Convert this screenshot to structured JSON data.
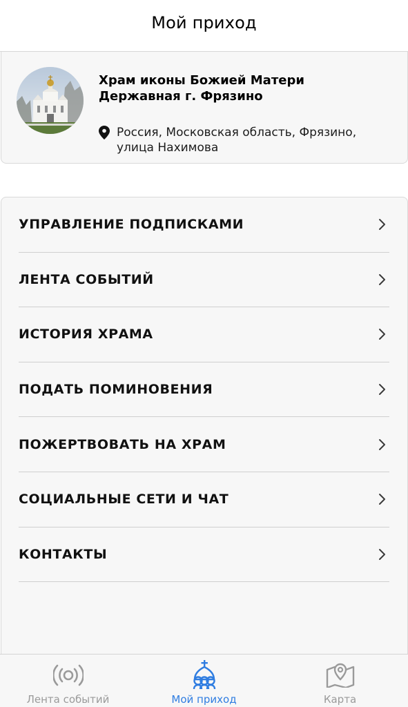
{
  "header": {
    "title": "Мой приход"
  },
  "church": {
    "name_line1": "Храм иконы Божией Матери",
    "name_line2": "Державная г. Фрязино",
    "address": "Россия, Московская область, Фрязино, улица Нахимова",
    "photo_icon": "church-photo",
    "location_icon": "map-pin-icon"
  },
  "menu": {
    "items": [
      {
        "label": "УПРАВЛЕНИЕ ПОДПИСКАМИ"
      },
      {
        "label": "ЛЕНТА СОБЫТИЙ"
      },
      {
        "label": "ИСТОРИЯ ХРАМА"
      },
      {
        "label": "ПОДАТЬ ПОМИНОВЕНИЯ"
      },
      {
        "label": "ПОЖЕРТВОВАТЬ НА ХРАМ"
      },
      {
        "label": "СОЦИАЛЬНЫЕ СЕТИ И ЧАТ"
      },
      {
        "label": "КОНТАКТЫ"
      }
    ],
    "chevron_icon": "chevron-right-icon"
  },
  "tabbar": {
    "tabs": [
      {
        "label": "Лента событий",
        "icon": "broadcast-icon",
        "active": false
      },
      {
        "label": "Мой приход",
        "icon": "church-dome-icon",
        "active": true
      },
      {
        "label": "Карта",
        "icon": "map-icon",
        "active": false
      }
    ],
    "active_color": "#2f7de1",
    "inactive_color": "#9a9a9a"
  }
}
